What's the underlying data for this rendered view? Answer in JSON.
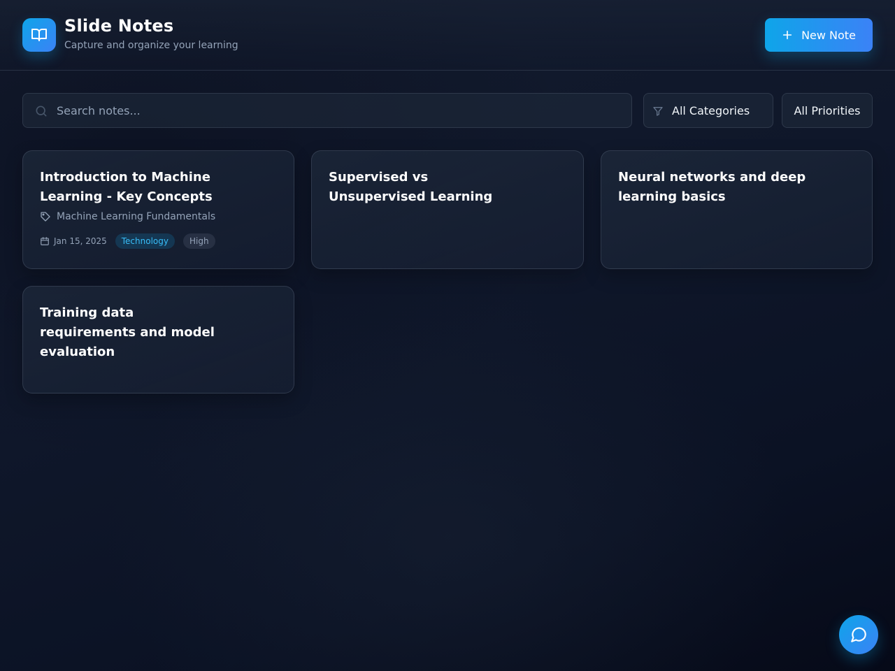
{
  "app": {
    "title": "Slide Notes",
    "subtitle": "Capture and organize your learning",
    "logo_icon": "book-open-icon",
    "accent_color": "#0ea5e9"
  },
  "toolbar": {
    "new_note_label": "New Note",
    "search_placeholder": "Search notes...",
    "category_filter": "All Categories",
    "priority_filter": "All Priorities"
  },
  "notes": [
    {
      "title": "Introduction to Machine Learning - Key Concepts",
      "category": "Machine Learning Fundamentals",
      "date": "Jan 15, 2025",
      "category_badge": "Technology",
      "priority": "High"
    },
    {
      "title": "Supervised vs Unsupervised Learning"
    },
    {
      "title": "Neural networks and deep learning basics"
    },
    {
      "title": "Training data requirements and model evaluation"
    }
  ],
  "chat": {
    "icon": "message-circle-icon"
  }
}
